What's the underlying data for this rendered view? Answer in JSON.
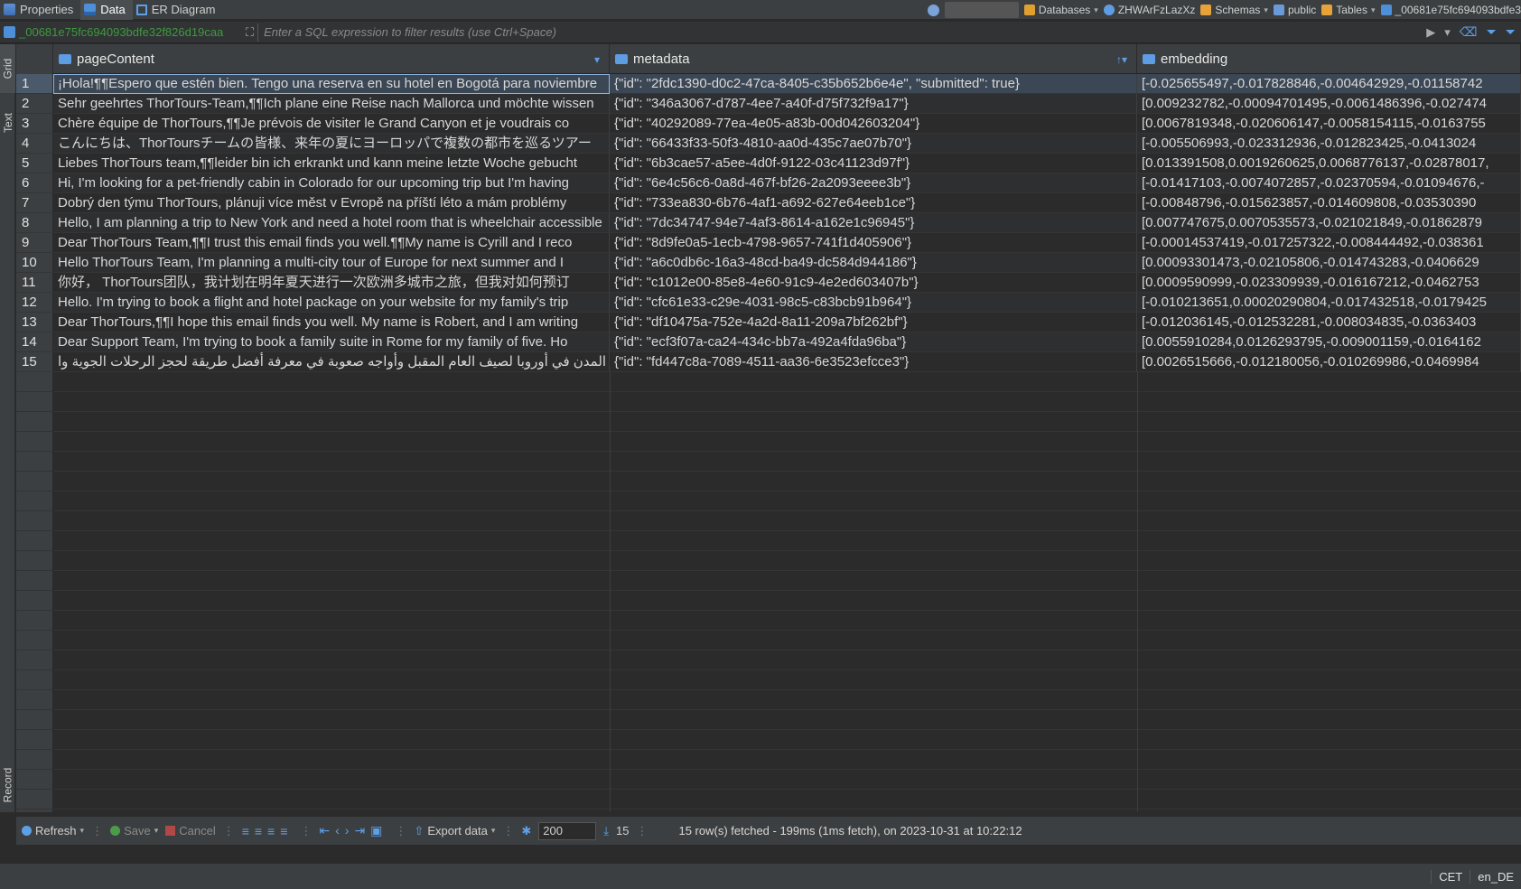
{
  "tabs": [
    {
      "label": "Properties",
      "icon": "properties-icon"
    },
    {
      "label": "Data",
      "icon": "data-grid-icon",
      "active": true
    },
    {
      "label": "ER Diagram",
      "icon": "er-diagram-icon"
    }
  ],
  "breadcrumbs": {
    "databases": "Databases",
    "connection": "ZHWArFzLazXz",
    "schemas": "Schemas",
    "schema": "public",
    "tables": "Tables",
    "table": "_00681e75fc694093bdfe3"
  },
  "filter": {
    "table_name": "_00681e75fc694093bdfe32f826d19caa",
    "placeholder": "Enter a SQL expression to filter results (use Ctrl+Space)"
  },
  "side_tabs": {
    "grid": "Grid",
    "text": "Text",
    "record": "Record"
  },
  "columns": [
    {
      "name": "pageContent"
    },
    {
      "name": "metadata"
    },
    {
      "name": "embedding"
    }
  ],
  "rows": [
    {
      "num": "1",
      "page": "¡Hola!¶¶Espero que estén bien. Tengo una reserva en su hotel en Bogotá para noviembre",
      "meta": "{\"id\": \"2fdc1390-d0c2-47ca-8405-c35b652b6e4e\", \"submitted\": true}",
      "emb": "[-0.025655497,-0.017828846,-0.004642929,-0.01158742"
    },
    {
      "num": "2",
      "page": "Sehr geehrtes ThorTours-Team,¶¶Ich plane eine Reise nach Mallorca und möchte wissen",
      "meta": "{\"id\": \"346a3067-d787-4ee7-a40f-d75f732f9a17\"}",
      "emb": "[0.009232782,-0.00094701495,-0.0061486396,-0.027474"
    },
    {
      "num": "3",
      "page": "Chère équipe de ThorTours,¶¶Je prévois de visiter le Grand Canyon et je voudrais co",
      "meta": "{\"id\": \"40292089-77ea-4e05-a83b-00d042603204\"}",
      "emb": "[0.0067819348,-0.020606147,-0.0058154115,-0.0163755"
    },
    {
      "num": "4",
      "page": "こんにちは、ThorToursチームの皆様、来年の夏にヨーロッパで複数の都市を巡るツアー",
      "meta": "{\"id\": \"66433f33-50f3-4810-aa0d-435c7ae07b70\"}",
      "emb": "[-0.005506993,-0.023312936,-0.012823425,-0.0413024"
    },
    {
      "num": "5",
      "page": "Liebes ThorTours team,¶¶leider bin ich erkrankt und kann meine letzte Woche gebucht",
      "meta": "{\"id\": \"6b3cae57-a5ee-4d0f-9122-03c41123d97f\"}",
      "emb": "[0.013391508,0.0019260625,0.0068776137,-0.02878017,"
    },
    {
      "num": "6",
      "page": "Hi, I'm looking for a pet-friendly cabin in Colorado for our upcoming trip but I'm having",
      "meta": "{\"id\": \"6e4c56c6-0a8d-467f-bf26-2a2093eeee3b\"}",
      "emb": "[-0.01417103,-0.0074072857,-0.02370594,-0.01094676,-"
    },
    {
      "num": "7",
      "page": "Dobrý den týmu ThorTours, plánuji více měst v Evropě na příští léto a mám problémy",
      "meta": "{\"id\": \"733ea830-6b76-4af1-a692-627e64eeb1ce\"}",
      "emb": "[-0.00848796,-0.015623857,-0.014609808,-0.03530390"
    },
    {
      "num": "8",
      "page": "Hello, I am planning a trip to New York and need a hotel room that is wheelchair accessible",
      "meta": "{\"id\": \"7dc34747-94e7-4af3-8614-a162e1c96945\"}",
      "emb": "[0.007747675,0.0070535573,-0.021021849,-0.01862879"
    },
    {
      "num": "9",
      "page": "Dear ThorTours Team,¶¶I trust this email finds you well.¶¶My name is Cyrill and I reco",
      "meta": "{\"id\": \"8d9fe0a5-1ecb-4798-9657-741f1d405906\"}",
      "emb": "[-0.00014537419,-0.017257322,-0.008444492,-0.038361"
    },
    {
      "num": "10",
      "page": "Hello ThorTours Team, I'm planning a multi-city tour of Europe for next summer and I",
      "meta": "{\"id\": \"a6c0db6c-16a3-48cd-ba49-dc584d944186\"}",
      "emb": "[0.00093301473,-0.02105806,-0.014743283,-0.0406629"
    },
    {
      "num": "11",
      "page": "你好， ThorTours团队，我计划在明年夏天进行一次欧洲多城市之旅，但我对如何预订",
      "meta": "{\"id\": \"c1012e00-85e8-4e60-91c9-4e2ed603407b\"}",
      "emb": "[0.0009590999,-0.023309939,-0.016167212,-0.0462753"
    },
    {
      "num": "12",
      "page": "Hello. I'm trying to book a flight and hotel package on your website for my family's trip",
      "meta": "{\"id\": \"cfc61e33-c29e-4031-98c5-c83bcb91b964\"}",
      "emb": "[-0.010213651,0.00020290804,-0.017432518,-0.0179425"
    },
    {
      "num": "13",
      "page": "Dear ThorTours,¶¶I hope this email finds you well. My name is Robert, and I am writing",
      "meta": "{\"id\": \"df10475a-752e-4a2d-8a11-209a7bf262bf\"}",
      "emb": "[-0.012036145,-0.012532281,-0.008034835,-0.0363403"
    },
    {
      "num": "14",
      "page": "Dear Support Team, I'm trying to book a family suite in Rome for my family of five. Ho",
      "meta": "{\"id\": \"ecf3f07a-ca24-434c-bb7a-492a4fda96ba\"}",
      "emb": "[0.0055910284,0.0126293795,-0.009001159,-0.0164162"
    },
    {
      "num": "15",
      "page": "المدن في أوروبا لصيف العام المقبل وأواجه صعوبة في معرفة أفضل طريقة لحجز الرحلات الجوية وا",
      "meta": "{\"id\": \"fd447c8a-7089-4511-aa36-6e3523efcce3\"}",
      "emb": "[0.0026515666,-0.012180056,-0.010269986,-0.0469984"
    }
  ],
  "toolbar": {
    "refresh": "Refresh",
    "save": "Save",
    "cancel": "Cancel",
    "export": "Export data",
    "max_rows": "200",
    "row_count": "15",
    "status": "15 row(s) fetched - 199ms (1ms fetch), on 2023-10-31 at 10:22:12"
  },
  "statusbar": {
    "timezone": "CET",
    "locale": "en_DE"
  }
}
